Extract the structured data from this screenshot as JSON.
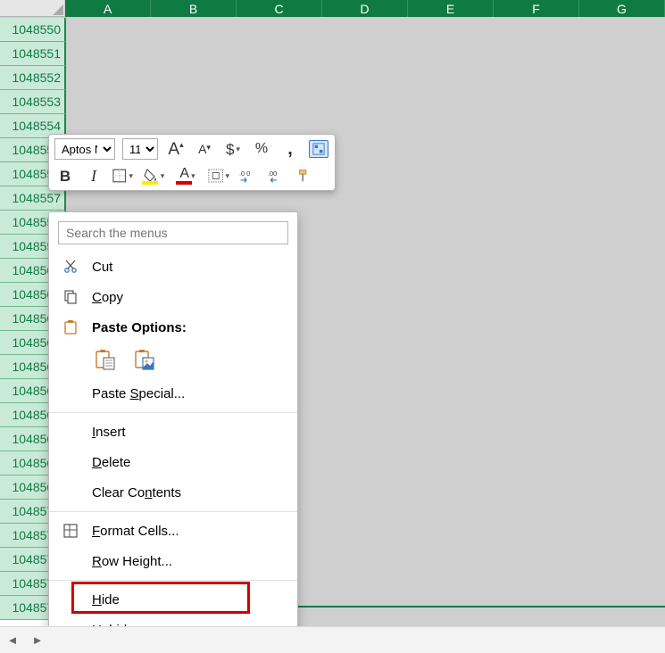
{
  "columns": [
    "A",
    "B",
    "C",
    "D",
    "E",
    "F",
    "G"
  ],
  "rows": [
    1048550,
    1048551,
    1048552,
    1048553,
    1048554,
    1048555,
    1048556,
    1048557,
    1048558,
    1048559,
    1048560,
    1048561,
    1048562,
    1048563,
    1048564,
    1048565,
    1048566,
    1048567,
    1048568,
    1048569,
    1048570,
    1048571,
    1048572,
    1048573,
    1048574
  ],
  "mini_toolbar": {
    "font_name": "Aptos Na",
    "font_size": "11"
  },
  "context_menu": {
    "search_placeholder": "Search the menus",
    "cut": "Cut",
    "copy": "Copy",
    "paste_options": "Paste Options:",
    "paste_special": "Paste Special...",
    "insert": "Insert",
    "delete": "Delete",
    "clear_contents": "Clear Contents",
    "format_cells": "Format Cells...",
    "row_height": "Row Height...",
    "hide": "Hide",
    "unhide": "Unhide"
  }
}
